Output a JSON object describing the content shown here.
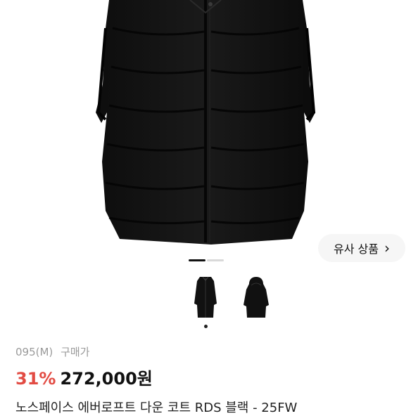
{
  "similar_button": {
    "label": "유사 상품",
    "chevron": "›"
  },
  "gallery": {
    "image_count": 2,
    "active_index": 0
  },
  "product": {
    "size_option": "095(M)",
    "purchase_label": "구매가",
    "discount": "31%",
    "price": "272,000원",
    "title": "노스페이스 에버로프트 다운 코트 RDS 블랙 - 25FW"
  },
  "icons": {
    "main_image": "black-long-padded-coat-image",
    "thumb_1": "coat-front-thumbnail-icon",
    "thumb_2": "coat-back-hooded-thumbnail-icon",
    "chevron": "chevron-right-icon"
  }
}
